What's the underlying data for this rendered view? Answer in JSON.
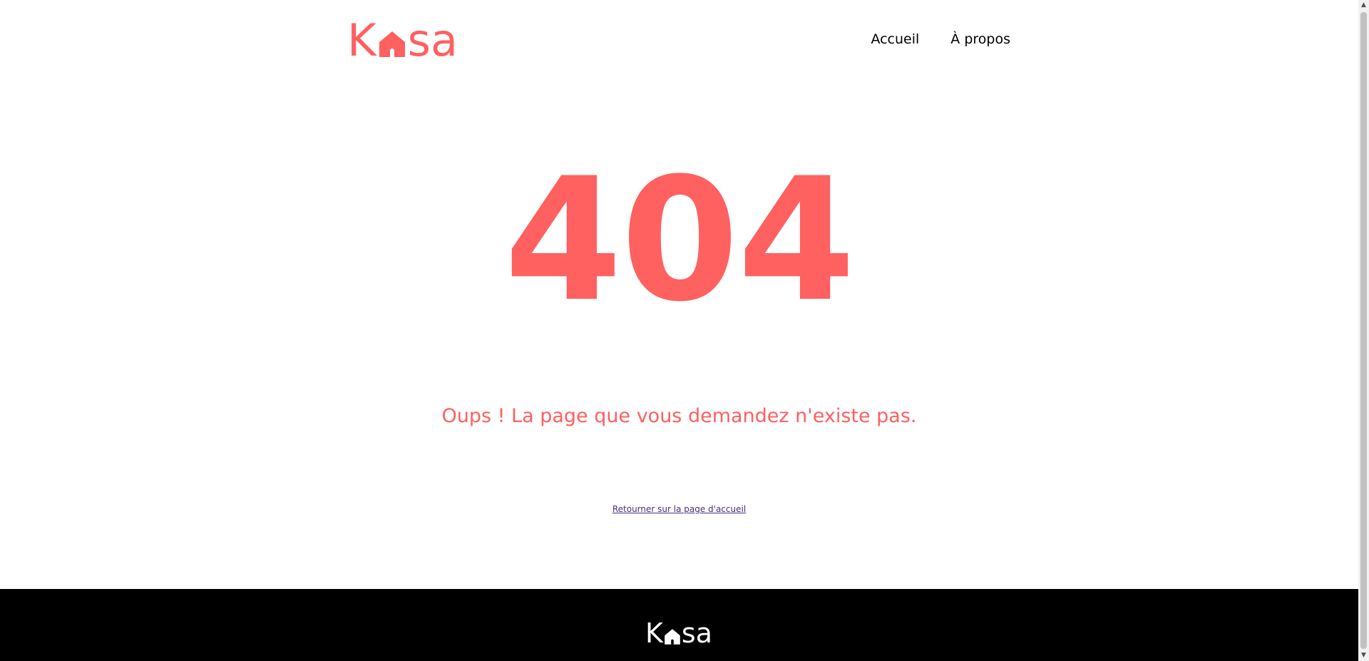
{
  "header": {
    "logo_first": "K",
    "logo_rest": "sa",
    "nav": {
      "home": "Accueil",
      "about": "À propos"
    }
  },
  "main": {
    "error_code": "404",
    "message": "Oups ! La page que vous demandez n'existe pas.",
    "home_link": "Retourner sur la page d'accueil"
  },
  "footer": {
    "logo_first": "K",
    "logo_rest": "sa"
  },
  "colors": {
    "brand": "#FF6060",
    "footer_bg": "#000000",
    "link_visited": "#4b2f7f"
  },
  "icons": {
    "logo_house": "house-icon",
    "scroll_up": "chevron-up-icon",
    "scroll_down": "chevron-down-icon"
  }
}
